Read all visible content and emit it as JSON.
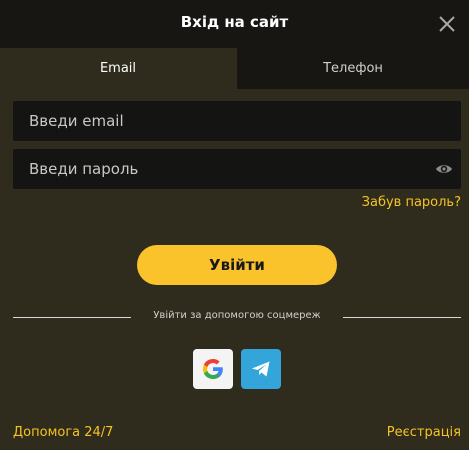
{
  "dialog": {
    "title": "Вхід на сайт"
  },
  "tabs": [
    {
      "label": "Email",
      "active": true
    },
    {
      "label": "Телефон",
      "active": false
    }
  ],
  "form": {
    "email_placeholder": "Введи email",
    "password_placeholder": "Введи пароль",
    "forgot_label": "Забув пароль?",
    "submit_label": "Увійти"
  },
  "social": {
    "divider_label": "Увійти за допомогою соцмереж",
    "providers": [
      {
        "icon": "google-icon"
      },
      {
        "icon": "telegram-icon"
      }
    ]
  },
  "footer": {
    "help_label": "Допомога 24/7",
    "register_label": "Реєстрація"
  },
  "colors": {
    "accent": "#fbc32b",
    "link": "#f5c324",
    "background": "#2f2c1d",
    "header": "#181613",
    "telegram": "#34a5db"
  }
}
